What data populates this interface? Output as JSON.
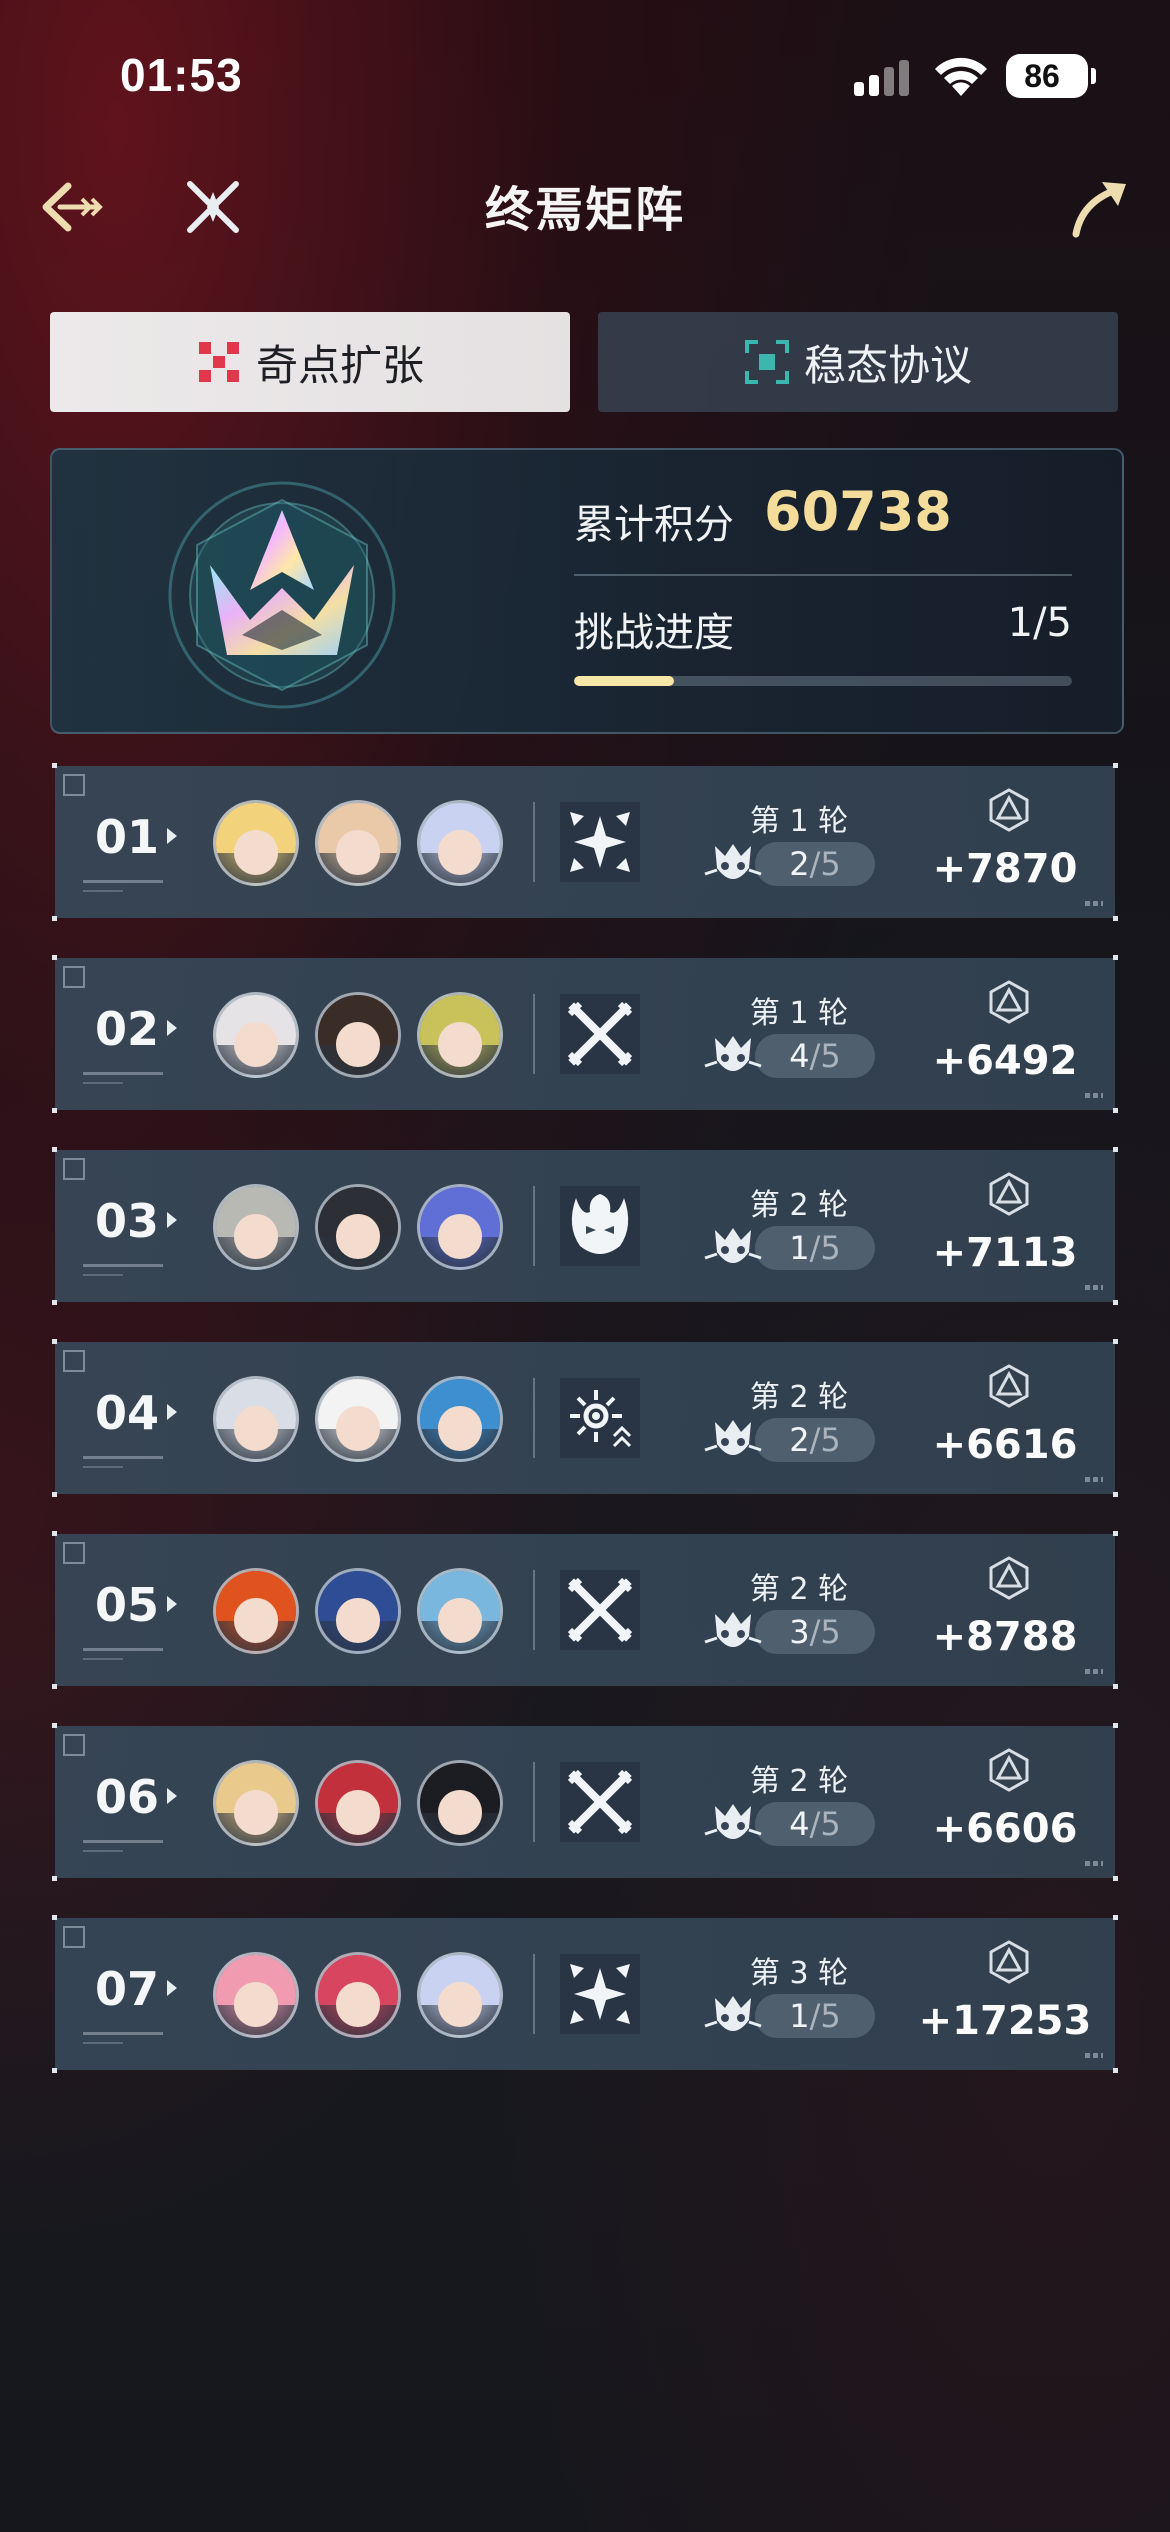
{
  "status_bar": {
    "time": "01:53",
    "battery": "86"
  },
  "header": {
    "title": "终焉矩阵"
  },
  "tabs": [
    {
      "label": "奇点扩张",
      "active": true
    },
    {
      "label": "稳态协议",
      "active": false
    }
  ],
  "summary": {
    "score_label": "累计积分",
    "score_value": "60738",
    "progress_label": "挑战进度",
    "progress_value": "1/5",
    "progress_fraction": 0.2
  },
  "stages": [
    {
      "num": "01",
      "round": "第 1 轮",
      "done": "2",
      "total": "/5",
      "score": "+7870",
      "buff_icon": "shatter-inward-icon",
      "avatars": [
        "#f2d27a",
        "#e9c9a8",
        "#c9d2f0"
      ]
    },
    {
      "num": "02",
      "round": "第 1 轮",
      "done": "4",
      "total": "/5",
      "score": "+6492",
      "buff_icon": "crossed-swords-icon",
      "avatars": [
        "#e6e3e6",
        "#3a2d28",
        "#c9c25a"
      ]
    },
    {
      "num": "03",
      "round": "第 2 轮",
      "done": "1",
      "total": "/5",
      "score": "+7113",
      "buff_icon": "flame-mask-icon",
      "avatars": [
        "#b9b9b4",
        "#2c2f35",
        "#5f6fd6"
      ]
    },
    {
      "num": "04",
      "round": "第 2 轮",
      "done": "2",
      "total": "/5",
      "score": "+6616",
      "buff_icon": "radiant-sun-icon",
      "avatars": [
        "#d8dde6",
        "#f3f3f3",
        "#3e8fd0"
      ]
    },
    {
      "num": "05",
      "round": "第 2 轮",
      "done": "3",
      "total": "/5",
      "score": "+8788",
      "buff_icon": "crossed-swords-icon",
      "avatars": [
        "#e0531f",
        "#2f4d94",
        "#7ab7df"
      ]
    },
    {
      "num": "06",
      "round": "第 2 轮",
      "done": "4",
      "total": "/5",
      "score": "+6606",
      "buff_icon": "crossed-swords-icon",
      "avatars": [
        "#e9c98c",
        "#c2303c",
        "#1c1d22"
      ]
    },
    {
      "num": "07",
      "round": "第 3 轮",
      "done": "1",
      "total": "/5",
      "score": "+17253",
      "buff_icon": "shatter-inward-icon",
      "avatars": [
        "#f19bb0",
        "#d8455f",
        "#c9d2f0"
      ]
    }
  ],
  "colors": {
    "accent_score": "#f4dc9a",
    "tab_active_bg": "#ece9ea",
    "panel_bg": "#364656"
  }
}
